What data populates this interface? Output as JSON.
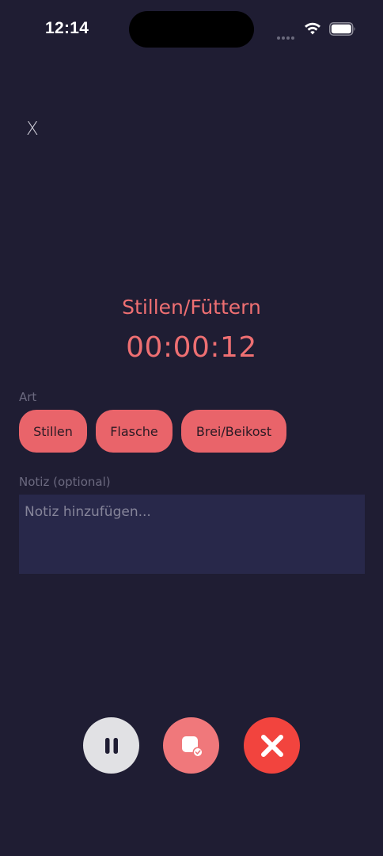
{
  "status_bar": {
    "time": "12:14"
  },
  "header": {
    "close_label": "X"
  },
  "session": {
    "title": "Stillen/Füttern",
    "timer": "00:00:12"
  },
  "type_section": {
    "label": "Art",
    "options": [
      "Stillen",
      "Flasche",
      "Brei/Beikost"
    ]
  },
  "note_section": {
    "label": "Notiz (optional)",
    "value": "",
    "placeholder": "Notiz hinzufügen..."
  },
  "controls": {
    "pause_icon": "pause-icon",
    "stop_icon": "stop-save-icon",
    "cancel_icon": "close-icon"
  },
  "colors": {
    "background": "#1f1d33",
    "accent": "#ee6f72",
    "chip": "#e9646a",
    "input_bg": "#28284a",
    "cancel": "#f2443e"
  }
}
